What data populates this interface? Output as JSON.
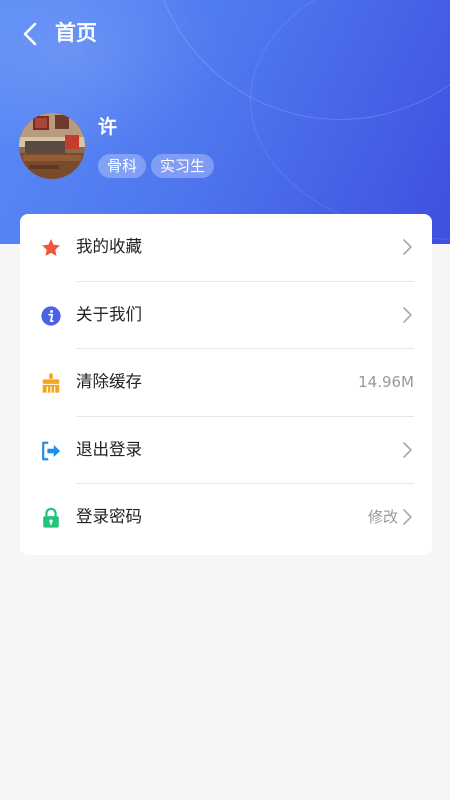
{
  "nav": {
    "title": "首页",
    "back_icon": "chevron-left-icon"
  },
  "profile": {
    "name": "许",
    "tags": [
      "骨科",
      "实习生"
    ]
  },
  "menu": [
    {
      "label": "我的收藏",
      "icon": "star-icon",
      "icon_color": "#f0573a",
      "right_text": "",
      "chevron": true
    },
    {
      "label": "关于我们",
      "icon": "info-icon",
      "icon_color": "#4a63e6",
      "right_text": "",
      "chevron": true
    },
    {
      "label": "清除缓存",
      "icon": "broom-icon",
      "icon_color": "#f4a51c",
      "right_text": "14.96M",
      "chevron": false
    },
    {
      "label": "退出登录",
      "icon": "logout-icon",
      "icon_color": "#1e8ee8",
      "right_text": "",
      "chevron": true
    },
    {
      "label": "登录密码",
      "icon": "lock-icon",
      "icon_color": "#20c47a",
      "right_text": "修改",
      "chevron": true
    }
  ],
  "colors": {
    "header_start": "#5b8cf6",
    "header_end": "#3d4fe0",
    "page_background": "#f6f6f6"
  }
}
